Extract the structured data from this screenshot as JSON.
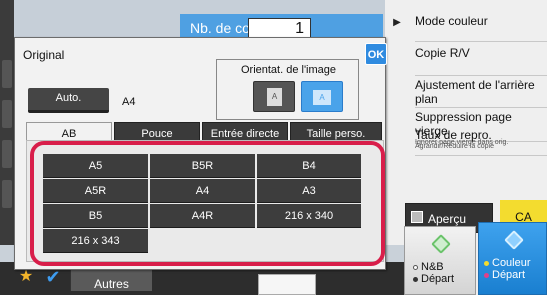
{
  "copies": {
    "label": "Nb. de copies",
    "value": "1"
  },
  "dialog": {
    "title": "Original",
    "ok_label": "OK",
    "auto_label": "Auto.",
    "auto_value": "A4",
    "orientation": {
      "label": "Orientat. de l'image",
      "options": [
        "A",
        "A"
      ],
      "selected": 1
    },
    "tabs": [
      {
        "label": "AB",
        "active": true
      },
      {
        "label": "Pouce",
        "active": false
      },
      {
        "label": "Entrée directe",
        "active": false
      },
      {
        "label": "Taille perso.",
        "active": false
      }
    ],
    "sizes": [
      "A5",
      "B5R",
      "B4",
      "A5R",
      "A4",
      "A3",
      "B5",
      "A4R",
      "216 x 340",
      "216 x 343"
    ]
  },
  "right_panel": {
    "items": [
      {
        "title": "Mode couleur",
        "sub": ""
      },
      {
        "title": "Copie R/V",
        "sub": ""
      },
      {
        "title": "Ajustement de l'arrière plan",
        "sub": ""
      },
      {
        "title": "Suppression page vierge",
        "sub": "Ignorer page vierge dans orig."
      },
      {
        "title": "Taux de repro.",
        "sub": "Agrandir/Réduire la copie"
      }
    ],
    "preview_label": "Aperçu",
    "ca_label": "CA",
    "start_bw": {
      "line1": "N&B",
      "line2": "Départ"
    },
    "start_color": {
      "line1": "Couleur",
      "line2": "Départ"
    }
  },
  "bottom": {
    "other_label": "Autres"
  },
  "colors": {
    "accent": "#4fa0e2",
    "highlight": "#d81e4a",
    "ca": "#f3dc2f"
  }
}
